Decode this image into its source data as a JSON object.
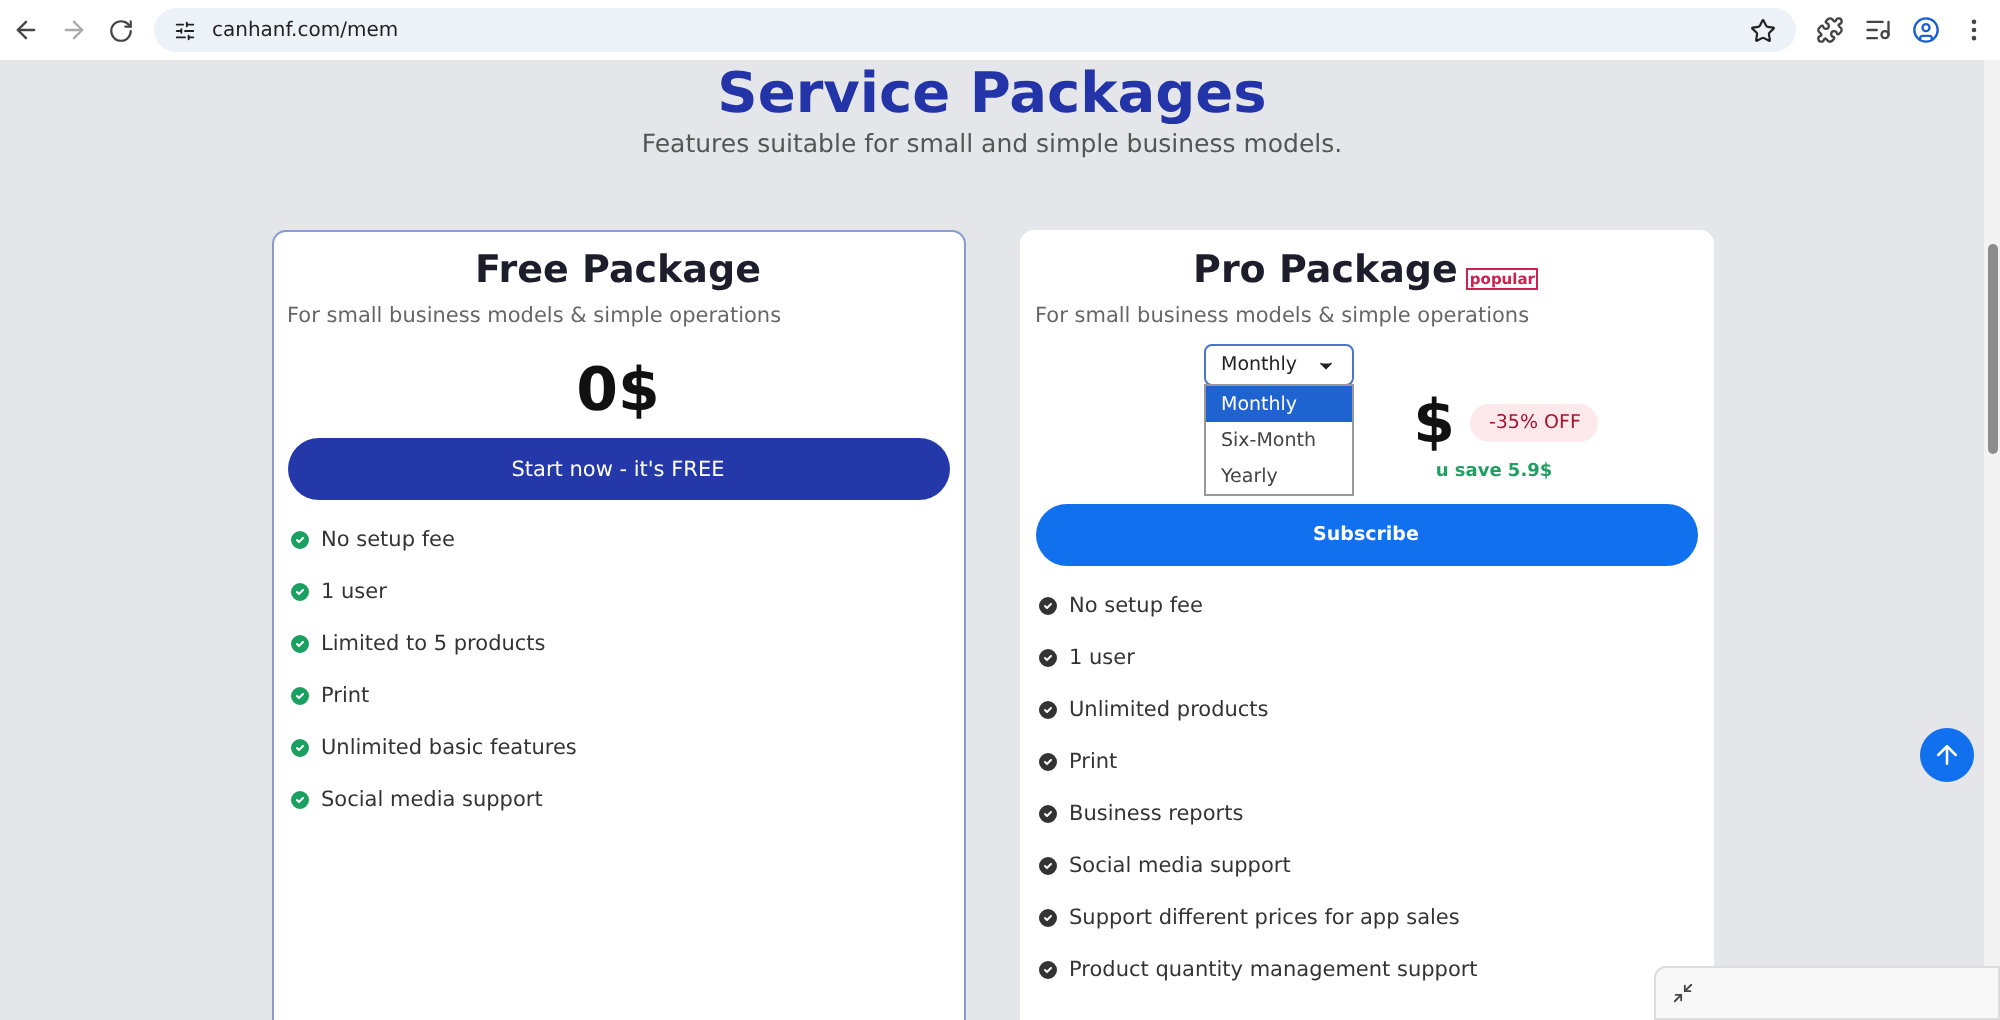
{
  "browser": {
    "url": "canhanf.com/mem"
  },
  "header": {
    "title": "Service Packages",
    "subtitle": "Features suitable for small and simple business models."
  },
  "packages": [
    {
      "kind": "free",
      "title": "Free Package",
      "description": "For small business models & simple operations",
      "price": "0$",
      "button": "Start now - it's FREE",
      "features": [
        "No setup fee",
        "1 user",
        "Limited to 5 products",
        "Print",
        "Unlimited basic features",
        "Social media support"
      ]
    },
    {
      "kind": "pro",
      "title": "Pro Package",
      "badge": "popular",
      "description": "For small business models & simple operations",
      "period": {
        "value": "Monthly",
        "expanded": true,
        "options": [
          {
            "label": "Monthly",
            "selected": true
          },
          {
            "label": "Six-Month",
            "selected": false
          },
          {
            "label": "Yearly",
            "selected": false
          }
        ]
      },
      "price": "$",
      "discount": "-35% OFF",
      "saving": "u save 5.9$",
      "button": "Subscribe",
      "features": [
        "No setup fee",
        "1 user",
        "Unlimited products",
        "Print",
        "Business reports",
        "Social media support",
        "Support different prices for app sales",
        "Product quantity management support"
      ]
    }
  ]
}
